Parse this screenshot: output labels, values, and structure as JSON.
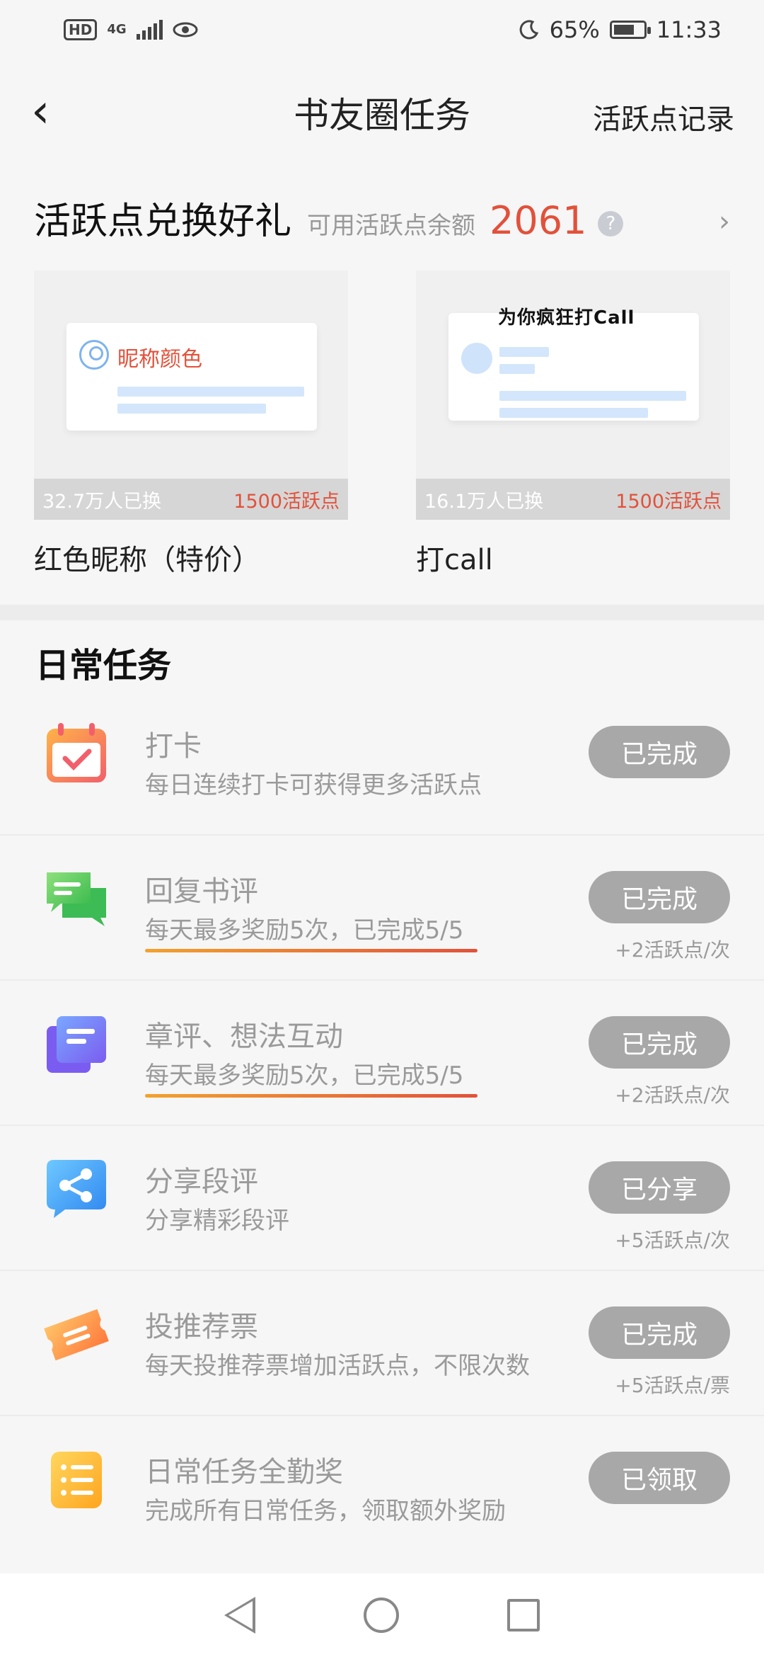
{
  "status_bar": {
    "hd": "HD",
    "network": "4G",
    "battery": "65%",
    "time": "11:33"
  },
  "nav": {
    "title": "书友圈任务",
    "right_link": "活跃点记录"
  },
  "exchange": {
    "title": "活跃点兑换好礼",
    "balance_label": "可用活跃点余额",
    "balance": "2061",
    "gifts": [
      {
        "preview_label": "昵称颜色",
        "count": "32.7万人已换",
        "price": "1500活跃点",
        "name": "红色昵称（特价）"
      },
      {
        "preview_label": "为你疯狂打Call",
        "count": "16.1万人已换",
        "price": "1500活跃点",
        "name": "打call"
      }
    ]
  },
  "daily": {
    "title": "日常任务",
    "tasks": [
      {
        "title": "打卡",
        "desc": "每日连续打卡可获得更多活跃点",
        "button": "已完成",
        "reward": "",
        "icon": "calendar-check-icon"
      },
      {
        "title": "回复书评",
        "desc": "每天最多奖励5次，已完成5/5",
        "button": "已完成",
        "reward": "+2活跃点/次",
        "icon": "chat-bubble-icon"
      },
      {
        "title": "章评、想法互动",
        "desc": "每天最多奖励5次，已完成5/5",
        "button": "已完成",
        "reward": "+2活跃点/次",
        "icon": "comment-stack-icon"
      },
      {
        "title": "分享段评",
        "desc": "分享精彩段评",
        "button": "已分享",
        "reward": "+5活跃点/次",
        "icon": "share-icon"
      },
      {
        "title": "投推荐票",
        "desc": "每天投推荐票增加活跃点，不限次数",
        "button": "已完成",
        "reward": "+5活跃点/票",
        "icon": "ticket-icon"
      },
      {
        "title": "日常任务全勤奖",
        "desc": "完成所有日常任务，领取额外奖励",
        "button": "已领取",
        "reward": "",
        "icon": "list-icon"
      }
    ]
  },
  "colors": {
    "accent": "#e2513b",
    "button_done": "#a8a8a8"
  }
}
